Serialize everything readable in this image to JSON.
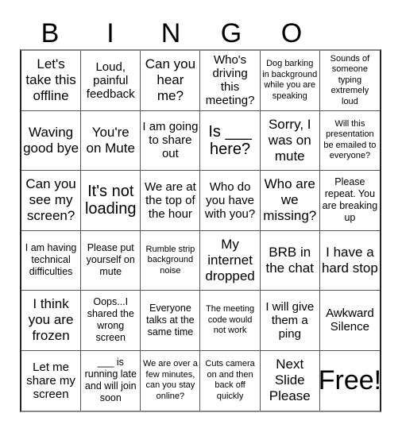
{
  "header": {
    "letters": [
      "B",
      "I",
      "N",
      "G",
      "O"
    ]
  },
  "cells": [
    {
      "text": "Let's take this offline",
      "size": "m"
    },
    {
      "text": "Loud, painful feedback",
      "size": "s"
    },
    {
      "text": "Can you hear me?",
      "size": "m"
    },
    {
      "text": "Who's driving this meeting?",
      "size": "s"
    },
    {
      "text": "Dog barking in background while you are speaking",
      "size": "xxs"
    },
    {
      "text": "Sounds of someone typing extremely loud",
      "size": "xxs"
    },
    {
      "text": "Waving good bye",
      "size": "m"
    },
    {
      "text": "You're on Mute",
      "size": "m"
    },
    {
      "text": "I am going to share out",
      "size": "s"
    },
    {
      "text": "Is ___ here?",
      "size": "l"
    },
    {
      "text": "Sorry, I was on mute",
      "size": "m"
    },
    {
      "text": "Will this presentation be emailed to everyone?",
      "size": "xxs"
    },
    {
      "text": "Can you see my screen?",
      "size": "m"
    },
    {
      "text": "It's not loading",
      "size": "l"
    },
    {
      "text": "We are at the top of the hour",
      "size": "s"
    },
    {
      "text": "Who do you have with you?",
      "size": "s"
    },
    {
      "text": "Who are we missing?",
      "size": "m"
    },
    {
      "text": "Please repeat. You are breaking up",
      "size": "xs"
    },
    {
      "text": "I am having technical difficulties",
      "size": "xs"
    },
    {
      "text": "Please put yourself on mute",
      "size": "xs"
    },
    {
      "text": "Rumble strip background noise",
      "size": "xxs"
    },
    {
      "text": "My internet dropped",
      "size": "m"
    },
    {
      "text": "BRB in the chat",
      "size": "m"
    },
    {
      "text": "I have a hard stop",
      "size": "m"
    },
    {
      "text": "I think you are frozen",
      "size": "m"
    },
    {
      "text": "Oops...I shared the wrong screen",
      "size": "xs"
    },
    {
      "text": "Everyone talks at the same time",
      "size": "xs"
    },
    {
      "text": "The meeting code would not work",
      "size": "xxs"
    },
    {
      "text": "I will give them a ping",
      "size": "s"
    },
    {
      "text": "Awkward Silence",
      "size": "s"
    },
    {
      "text": "Let me share my screen",
      "size": "s"
    },
    {
      "text": "___ is running late and will join soon",
      "size": "xs"
    },
    {
      "text": "We are over a few minutes, can you stay online?",
      "size": "xxs"
    },
    {
      "text": "Cuts camera on and then back off quickly",
      "size": "xxs"
    },
    {
      "text": "Next Slide Please",
      "size": "m"
    },
    {
      "text": "Free!",
      "size": "xl"
    }
  ]
}
